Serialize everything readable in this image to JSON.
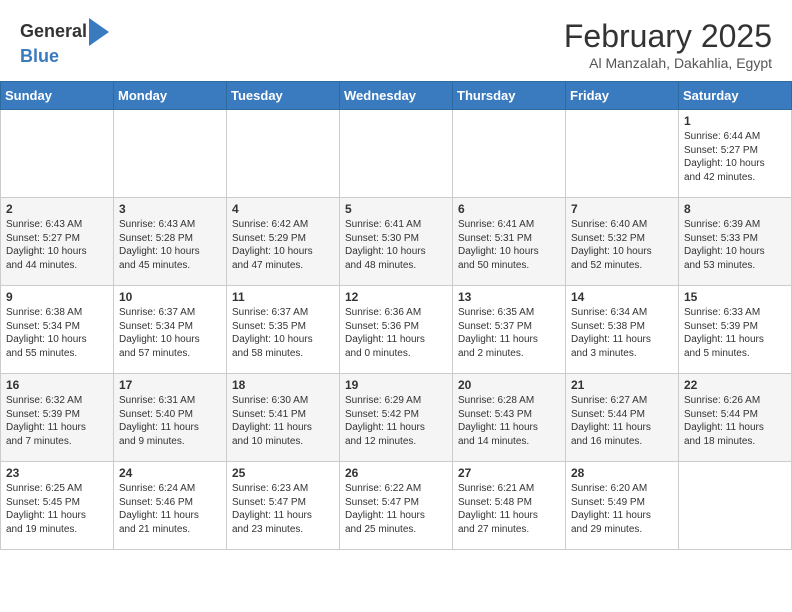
{
  "header": {
    "logo_line1": "General",
    "logo_line2": "Blue",
    "month": "February 2025",
    "location": "Al Manzalah, Dakahlia, Egypt"
  },
  "weekdays": [
    "Sunday",
    "Monday",
    "Tuesday",
    "Wednesday",
    "Thursday",
    "Friday",
    "Saturday"
  ],
  "weeks": [
    [
      {
        "day": "",
        "info": ""
      },
      {
        "day": "",
        "info": ""
      },
      {
        "day": "",
        "info": ""
      },
      {
        "day": "",
        "info": ""
      },
      {
        "day": "",
        "info": ""
      },
      {
        "day": "",
        "info": ""
      },
      {
        "day": "1",
        "info": "Sunrise: 6:44 AM\nSunset: 5:27 PM\nDaylight: 10 hours\nand 42 minutes."
      }
    ],
    [
      {
        "day": "2",
        "info": "Sunrise: 6:43 AM\nSunset: 5:27 PM\nDaylight: 10 hours\nand 44 minutes."
      },
      {
        "day": "3",
        "info": "Sunrise: 6:43 AM\nSunset: 5:28 PM\nDaylight: 10 hours\nand 45 minutes."
      },
      {
        "day": "4",
        "info": "Sunrise: 6:42 AM\nSunset: 5:29 PM\nDaylight: 10 hours\nand 47 minutes."
      },
      {
        "day": "5",
        "info": "Sunrise: 6:41 AM\nSunset: 5:30 PM\nDaylight: 10 hours\nand 48 minutes."
      },
      {
        "day": "6",
        "info": "Sunrise: 6:41 AM\nSunset: 5:31 PM\nDaylight: 10 hours\nand 50 minutes."
      },
      {
        "day": "7",
        "info": "Sunrise: 6:40 AM\nSunset: 5:32 PM\nDaylight: 10 hours\nand 52 minutes."
      },
      {
        "day": "8",
        "info": "Sunrise: 6:39 AM\nSunset: 5:33 PM\nDaylight: 10 hours\nand 53 minutes."
      }
    ],
    [
      {
        "day": "9",
        "info": "Sunrise: 6:38 AM\nSunset: 5:34 PM\nDaylight: 10 hours\nand 55 minutes."
      },
      {
        "day": "10",
        "info": "Sunrise: 6:37 AM\nSunset: 5:34 PM\nDaylight: 10 hours\nand 57 minutes."
      },
      {
        "day": "11",
        "info": "Sunrise: 6:37 AM\nSunset: 5:35 PM\nDaylight: 10 hours\nand 58 minutes."
      },
      {
        "day": "12",
        "info": "Sunrise: 6:36 AM\nSunset: 5:36 PM\nDaylight: 11 hours\nand 0 minutes."
      },
      {
        "day": "13",
        "info": "Sunrise: 6:35 AM\nSunset: 5:37 PM\nDaylight: 11 hours\nand 2 minutes."
      },
      {
        "day": "14",
        "info": "Sunrise: 6:34 AM\nSunset: 5:38 PM\nDaylight: 11 hours\nand 3 minutes."
      },
      {
        "day": "15",
        "info": "Sunrise: 6:33 AM\nSunset: 5:39 PM\nDaylight: 11 hours\nand 5 minutes."
      }
    ],
    [
      {
        "day": "16",
        "info": "Sunrise: 6:32 AM\nSunset: 5:39 PM\nDaylight: 11 hours\nand 7 minutes."
      },
      {
        "day": "17",
        "info": "Sunrise: 6:31 AM\nSunset: 5:40 PM\nDaylight: 11 hours\nand 9 minutes."
      },
      {
        "day": "18",
        "info": "Sunrise: 6:30 AM\nSunset: 5:41 PM\nDaylight: 11 hours\nand 10 minutes."
      },
      {
        "day": "19",
        "info": "Sunrise: 6:29 AM\nSunset: 5:42 PM\nDaylight: 11 hours\nand 12 minutes."
      },
      {
        "day": "20",
        "info": "Sunrise: 6:28 AM\nSunset: 5:43 PM\nDaylight: 11 hours\nand 14 minutes."
      },
      {
        "day": "21",
        "info": "Sunrise: 6:27 AM\nSunset: 5:44 PM\nDaylight: 11 hours\nand 16 minutes."
      },
      {
        "day": "22",
        "info": "Sunrise: 6:26 AM\nSunset: 5:44 PM\nDaylight: 11 hours\nand 18 minutes."
      }
    ],
    [
      {
        "day": "23",
        "info": "Sunrise: 6:25 AM\nSunset: 5:45 PM\nDaylight: 11 hours\nand 19 minutes."
      },
      {
        "day": "24",
        "info": "Sunrise: 6:24 AM\nSunset: 5:46 PM\nDaylight: 11 hours\nand 21 minutes."
      },
      {
        "day": "25",
        "info": "Sunrise: 6:23 AM\nSunset: 5:47 PM\nDaylight: 11 hours\nand 23 minutes."
      },
      {
        "day": "26",
        "info": "Sunrise: 6:22 AM\nSunset: 5:47 PM\nDaylight: 11 hours\nand 25 minutes."
      },
      {
        "day": "27",
        "info": "Sunrise: 6:21 AM\nSunset: 5:48 PM\nDaylight: 11 hours\nand 27 minutes."
      },
      {
        "day": "28",
        "info": "Sunrise: 6:20 AM\nSunset: 5:49 PM\nDaylight: 11 hours\nand 29 minutes."
      },
      {
        "day": "",
        "info": ""
      }
    ]
  ]
}
